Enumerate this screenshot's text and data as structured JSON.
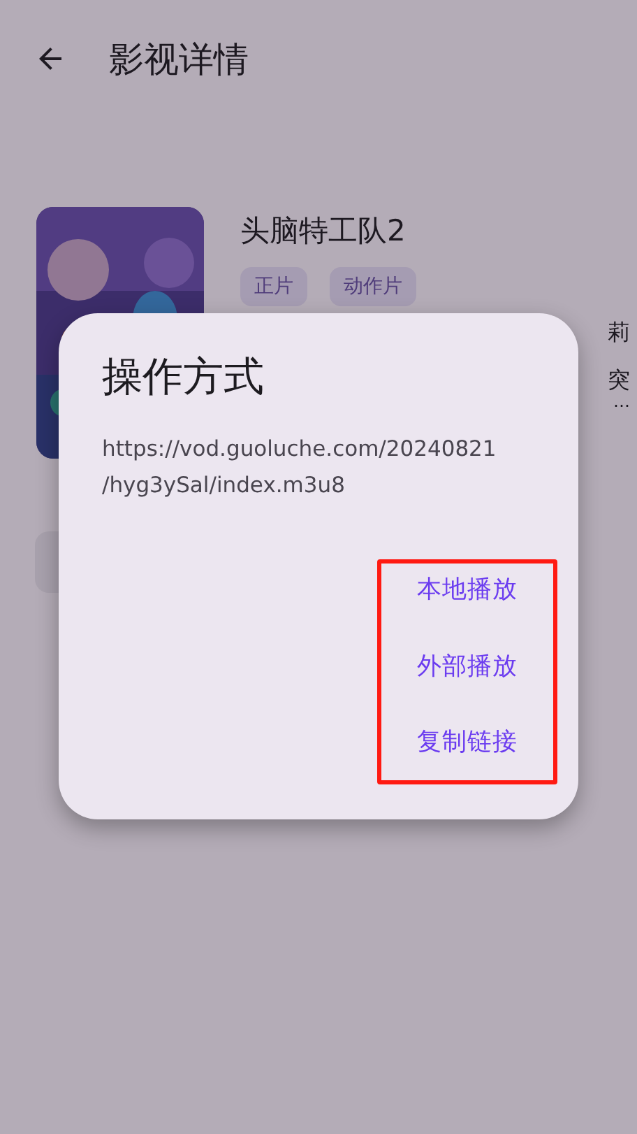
{
  "header": {
    "title": "影视详情"
  },
  "movie": {
    "title": "头脑特工队2",
    "tags": [
      "正片",
      "动作片"
    ],
    "description_fragments": [
      "莉",
      "突",
      "…"
    ]
  },
  "dialog": {
    "title": "操作方式",
    "url": "https://vod.guoluche.com/20240821\n/hyg3ySal/index.m3u8",
    "actions": [
      "本地播放",
      "外部播放",
      "复制链接"
    ]
  }
}
